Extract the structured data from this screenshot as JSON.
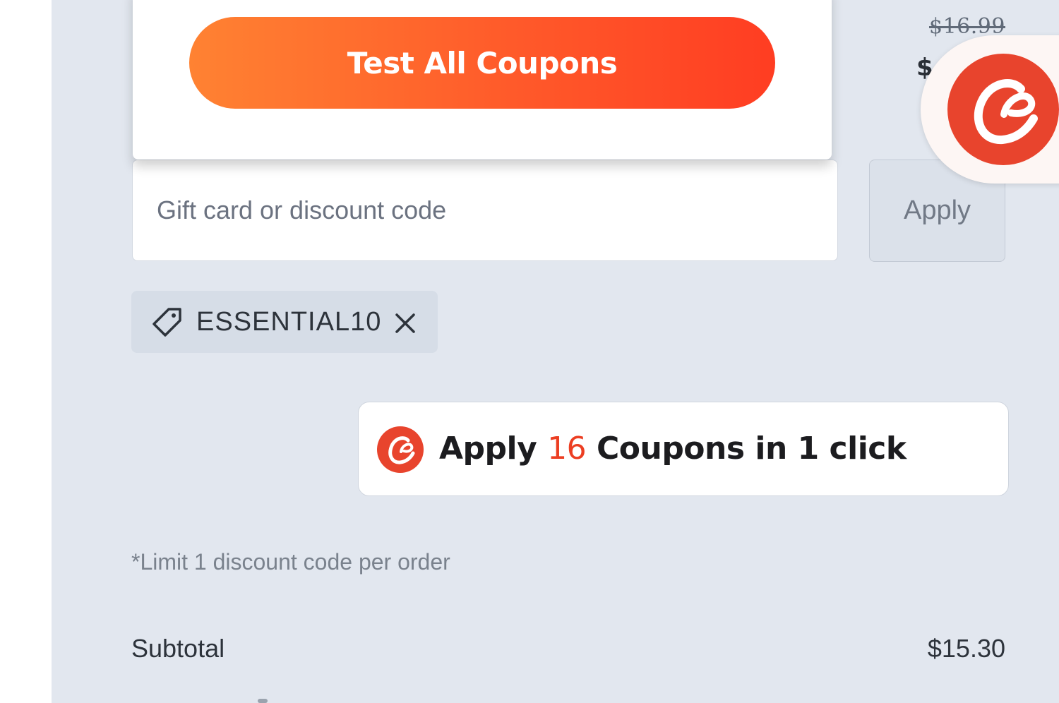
{
  "pricing": {
    "compare_at_price": "$16.99",
    "current_price_partial": "$"
  },
  "coupon_popup": {
    "test_all_label": "Test All Coupons"
  },
  "discount": {
    "input_placeholder": "Gift card or discount code",
    "input_value": "",
    "apply_label": "Apply",
    "applied_code": "ESSENTIAL10",
    "limit_note": "*Limit 1 discount code per order"
  },
  "one_click": {
    "prefix": "Apply",
    "count": "16",
    "suffix": "Coupons in 1 click"
  },
  "summary": {
    "subtotal_label": "Subtotal",
    "subtotal_value": "$15.30"
  },
  "icons": {
    "brand_logo": "brand-logo-icon",
    "tag": "tag-icon",
    "close": "close-icon"
  },
  "colors": {
    "brand_red": "#e8442d",
    "button_gradient_start": "#ff8232",
    "button_gradient_end": "#ff3d22",
    "coupon_count": "#ec3e22",
    "panel_background": "#e2e7ef"
  }
}
